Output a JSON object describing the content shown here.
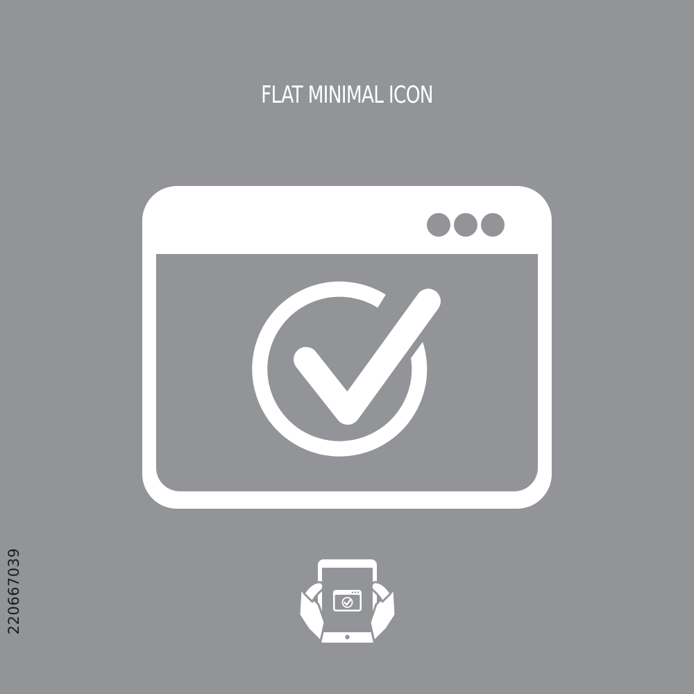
{
  "title": "FLAT MINIMAL ICON",
  "stock_id": "220667039",
  "colors": {
    "background": "#929498",
    "icon": "#ffffff",
    "id_text": "#1c1c1c"
  },
  "icons": {
    "main": "browser-window-checkmark-icon",
    "preview": "tablet-in-hands-icon"
  }
}
